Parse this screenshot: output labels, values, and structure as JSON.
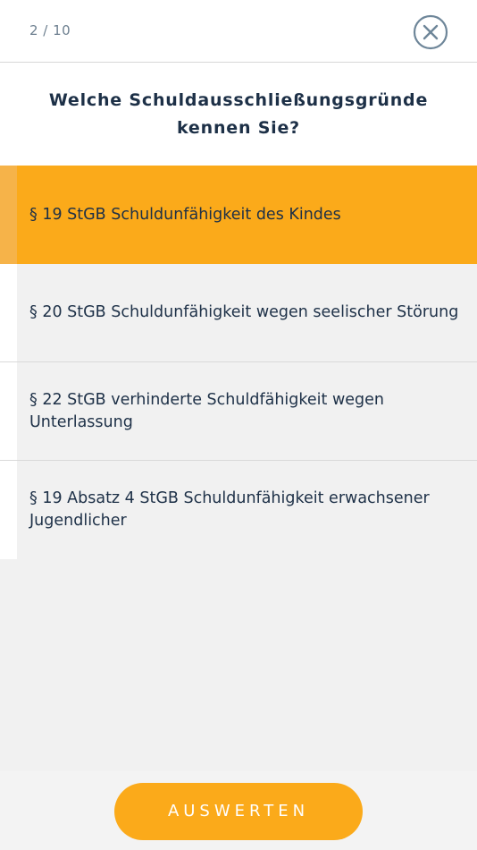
{
  "header": {
    "progress": "2 / 10",
    "close_icon": "close-circle-icon"
  },
  "question": {
    "text": "Welche Schuldausschließungsgründe kennen Sie?"
  },
  "options": [
    {
      "label": "§ 19 StGB Schuldunfähigkeit des Kindes",
      "selected": true
    },
    {
      "label": "§ 20 StGB Schuldunfähigkeit wegen seelischer Störung",
      "selected": false
    },
    {
      "label": "§ 22 StGB verhinderte Schuldfähigkeit wegen Unterlassung",
      "selected": false
    },
    {
      "label": "§ 19 Absatz 4 StGB Schuldunfähigkeit erwachsener Jugendlicher",
      "selected": false
    }
  ],
  "footer": {
    "submit_label": "AUSWERTEN"
  },
  "colors": {
    "accent": "#fbaa1a",
    "text": "#1d3047",
    "muted": "#6e8090",
    "background": "#f1f1f1"
  }
}
